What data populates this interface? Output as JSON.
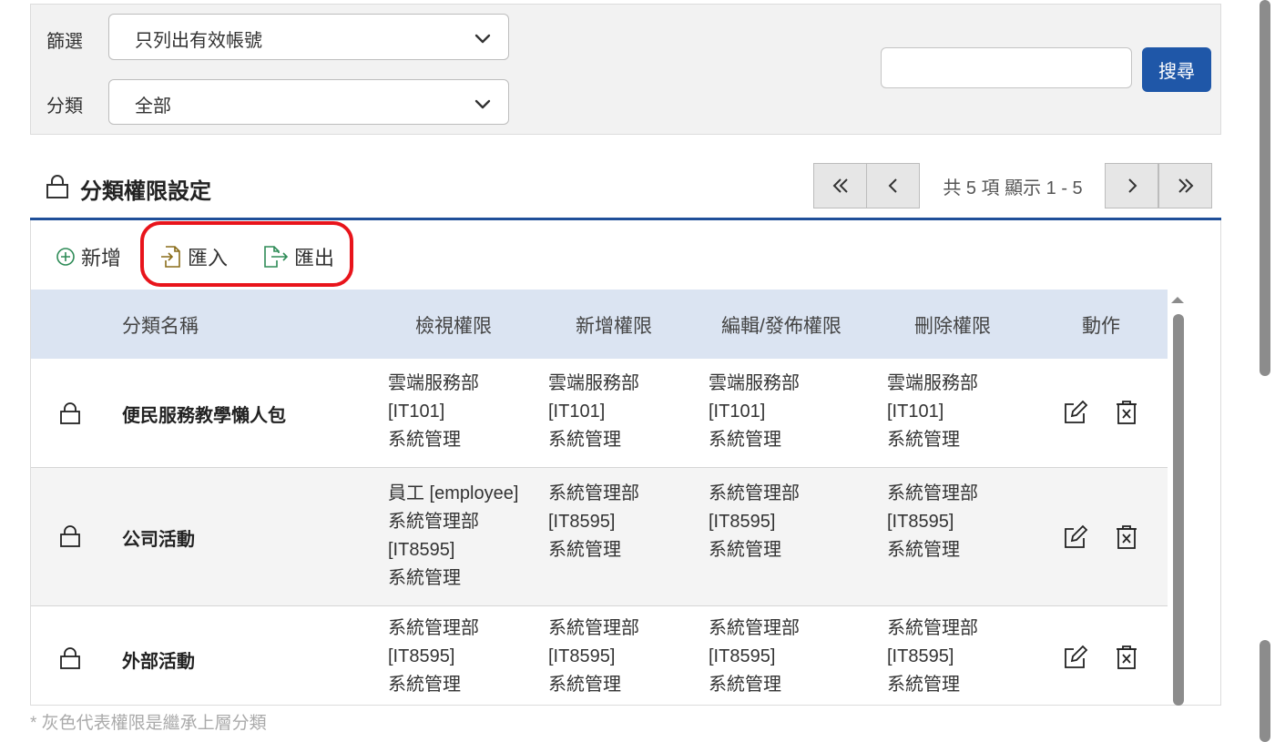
{
  "filter": {
    "filter_label": "篩選",
    "filter_value": "只列出有效帳號",
    "category_label": "分類",
    "category_value": "全部",
    "search_value": "",
    "search_button": "搜尋"
  },
  "section": {
    "title": "分類權限設定",
    "pager_info": "共 5 項 顯示 1 - 5"
  },
  "toolbar": {
    "add": "新增",
    "import": "匯入",
    "export": "匯出"
  },
  "table": {
    "headers": [
      "分類名稱",
      "檢視權限",
      "新增權限",
      "編輯/發佈權限",
      "刪除權限",
      "動作"
    ],
    "rows": [
      {
        "name": "便民服務教學懶人包",
        "view": [
          "雲端服務部",
          "[IT101]",
          "系統管理"
        ],
        "add": [
          "雲端服務部",
          "[IT101]",
          "系統管理"
        ],
        "edit": [
          "雲端服務部",
          "[IT101]",
          "系統管理"
        ],
        "delete": [
          "雲端服務部",
          "[IT101]",
          "系統管理"
        ]
      },
      {
        "name": "公司活動",
        "view": [
          "員工 [employee]",
          "系統管理部",
          "[IT8595]",
          "系統管理"
        ],
        "add": [
          "系統管理部",
          "[IT8595]",
          "系統管理"
        ],
        "edit": [
          "系統管理部",
          "[IT8595]",
          "系統管理"
        ],
        "delete": [
          "系統管理部",
          "[IT8595]",
          "系統管理"
        ]
      },
      {
        "name": "外部活動",
        "view": [
          "系統管理部",
          "[IT8595]",
          "系統管理"
        ],
        "add": [
          "系統管理部",
          "[IT8595]",
          "系統管理"
        ],
        "edit": [
          "系統管理部",
          "[IT8595]",
          "系統管理"
        ],
        "delete": [
          "系統管理部",
          "[IT8595]",
          "系統管理"
        ]
      }
    ]
  },
  "footnote": "* 灰色代表權限是繼承上層分類",
  "colors": {
    "primary": "#1f57a8",
    "header_bg": "#dbe4f2",
    "highlight": "#e8141b",
    "import_icon": "#8a6d1a",
    "export_icon": "#2e8b57",
    "add_icon": "#2e8b57"
  },
  "icons": {
    "chevron": "chevron-down-icon",
    "lock": "lock-icon",
    "add": "plus-circle-icon",
    "import": "file-import-icon",
    "export": "file-export-icon",
    "edit": "edit-icon",
    "delete": "trash-icon",
    "first": "double-chevron-left-icon",
    "prev": "chevron-left-icon",
    "next": "chevron-right-icon",
    "last": "double-chevron-right-icon"
  }
}
